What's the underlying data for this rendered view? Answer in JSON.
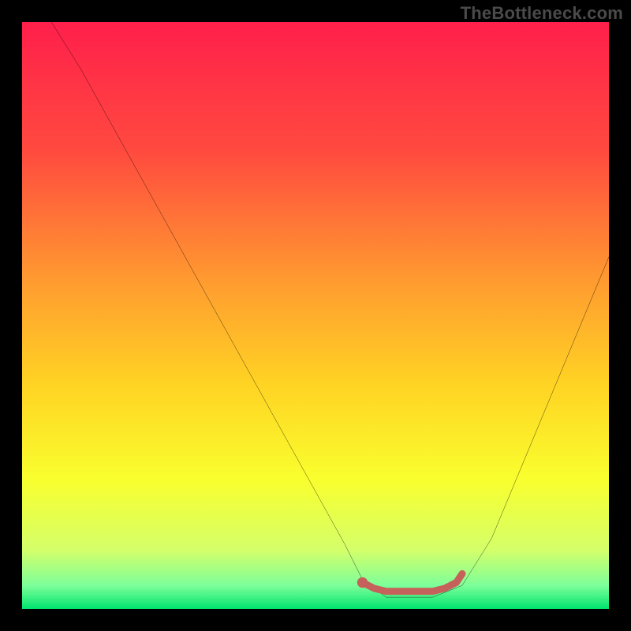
{
  "watermark": "TheBottleneck.com",
  "chart_data": {
    "type": "line",
    "title": "",
    "xlabel": "",
    "ylabel": "",
    "xlim": [
      0,
      100
    ],
    "ylim": [
      0,
      100
    ],
    "gradient_stops": [
      {
        "offset": 0.0,
        "color": "#ff1f4b"
      },
      {
        "offset": 0.22,
        "color": "#ff4a3f"
      },
      {
        "offset": 0.45,
        "color": "#ff9e2f"
      },
      {
        "offset": 0.62,
        "color": "#ffd423"
      },
      {
        "offset": 0.78,
        "color": "#f9ff2e"
      },
      {
        "offset": 0.9,
        "color": "#d4ff6a"
      },
      {
        "offset": 0.96,
        "color": "#7dff9a"
      },
      {
        "offset": 1.0,
        "color": "#00e46f"
      }
    ],
    "series": [
      {
        "name": "bottleneck-curve",
        "color": "#000000",
        "x": [
          5,
          10,
          15,
          20,
          25,
          30,
          35,
          40,
          45,
          50,
          55,
          58,
          62,
          70,
          75,
          80,
          85,
          90,
          95,
          100
        ],
        "y": [
          100,
          92,
          83,
          74,
          65,
          56,
          47,
          38,
          29,
          20,
          11,
          5,
          2,
          2,
          4,
          12,
          24,
          36,
          48,
          60
        ]
      },
      {
        "name": "optimal-range-marker",
        "color": "#c6605a",
        "x": [
          58,
          60,
          62,
          64,
          66,
          68,
          70,
          72,
          74,
          75
        ],
        "y": [
          4.5,
          3.5,
          3,
          3,
          3,
          3,
          3,
          3.5,
          4.5,
          6
        ]
      }
    ],
    "marker_dot": {
      "x": 58,
      "y": 4.5,
      "r": 0.9,
      "color": "#c6605a"
    }
  }
}
